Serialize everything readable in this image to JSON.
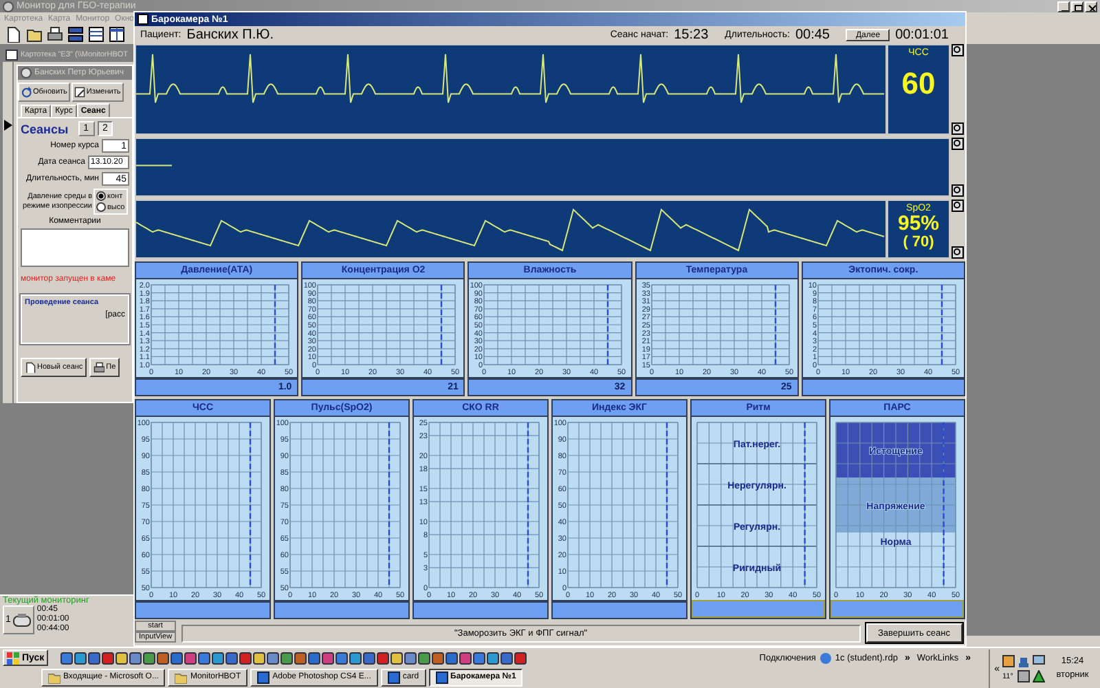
{
  "background_app": {
    "title": "Монитор для ГБО-терапии",
    "menu": [
      "Картотека",
      "Карта",
      "Монитор",
      "Окно"
    ],
    "card_window": {
      "title": "Картотека \"ЕЗ\" (\\\\MonitorHBOT",
      "patient_window": {
        "title": "Банских Петр Юрьевич",
        "buttons": [
          "Обновить",
          "Изменить"
        ],
        "tabs": [
          {
            "label": "Карта",
            "selected": false
          },
          {
            "label": "Курс",
            "selected": false
          },
          {
            "label": "Сеанс",
            "selected": true
          }
        ],
        "sessions_label": "Сеансы",
        "session_tabs": [
          {
            "label": "1",
            "selected": false
          },
          {
            "label": "2",
            "selected": true
          }
        ],
        "fields": [
          {
            "label": "Номер курса",
            "value": "1"
          },
          {
            "label": "Дата сеанса",
            "value": "13.10.20"
          },
          {
            "label": "Длительность, мин",
            "value": "45"
          }
        ],
        "pressure_label": "Давление среды в режиме изопрессии",
        "pressure_options": [
          {
            "label": "конт",
            "selected": true
          },
          {
            "label": "высо",
            "selected": false
          }
        ],
        "comments_label": "Комментарии",
        "status_message": "монитор запущен в каме",
        "session_group": {
          "title": "Проведение сеанса",
          "text": "[расс"
        },
        "bottom_buttons": [
          "Новый сеанс",
          "Пе"
        ]
      }
    },
    "monitoring_panel": {
      "title": "Текущий мониторинг",
      "items": [
        {
          "number": "1",
          "times": [
            "00:45",
            "00:01:00",
            "00:44:00"
          ]
        }
      ]
    }
  },
  "chamber_window": {
    "title": "Барокамера №1",
    "patient_label": "Пациент:",
    "patient": "Банских П.Ю.",
    "start_label": "Сеанс начат:",
    "start_time": "15:23",
    "duration_label": "Длительность:",
    "duration": "00:45",
    "next_button": "Далее",
    "elapsed": "00:01:01",
    "monitors": [
      {
        "kind": "ecg",
        "label": "ЧСС",
        "value": "60"
      },
      {
        "kind": "empty"
      },
      {
        "kind": "pulse",
        "label": "SpO2",
        "value": "95%",
        "sub_value": "( 70)"
      }
    ],
    "trend_rows": [
      [
        {
          "title": "Давление(АТА)",
          "reading": "1.0",
          "chart_data": {
            "type": "line",
            "grid": true,
            "xlim": [
              0,
              50
            ],
            "ylim": [
              1,
              2
            ],
            "xticks": [
              0,
              10,
              20,
              30,
              40,
              50
            ],
            "yticks": [
              {
                "value": 1,
                "label": "1.0"
              },
              1.1,
              1.2,
              1.3,
              1.4,
              1.5,
              1.6,
              1.7,
              1.8,
              1.9,
              {
                "value": 2,
                "label": "2.0"
              }
            ],
            "ref_lines": [
              {
                "axis": "x",
                "value": 45,
                "color": "#2a4ae0"
              }
            ]
          }
        },
        {
          "title": "Концентрация O2",
          "reading": "21",
          "chart_data": {
            "type": "line",
            "grid": true,
            "xlim": [
              0,
              50
            ],
            "ylim": [
              0,
              100
            ],
            "xticks": [
              0,
              10,
              20,
              30,
              40,
              50
            ],
            "yticks": [
              0,
              10,
              20,
              30,
              40,
              50,
              60,
              70,
              80,
              90,
              100
            ],
            "ref_lines": [
              {
                "axis": "x",
                "value": 45,
                "color": "#2a4ae0"
              }
            ]
          }
        },
        {
          "title": "Влажность",
          "reading": "32",
          "chart_data": {
            "type": "line",
            "grid": true,
            "xlim": [
              0,
              50
            ],
            "ylim": [
              0,
              100
            ],
            "xticks": [
              0,
              10,
              20,
              30,
              40,
              50
            ],
            "yticks": [
              0,
              10,
              20,
              30,
              40,
              50,
              60,
              70,
              80,
              90,
              100
            ],
            "ref_lines": [
              {
                "axis": "x",
                "value": 45,
                "color": "#2a4ae0"
              }
            ]
          }
        },
        {
          "title": "Температура",
          "reading": "25",
          "chart_data": {
            "type": "line",
            "grid": true,
            "xlim": [
              0,
              50
            ],
            "ylim": [
              15,
              35
            ],
            "xticks": [
              0,
              10,
              20,
              30,
              40,
              50
            ],
            "yticks": [
              15,
              17,
              19,
              21,
              23,
              25,
              27,
              29,
              31,
              33,
              35
            ],
            "ref_lines": [
              {
                "axis": "x",
                "value": 45,
                "color": "#2a4ae0"
              }
            ]
          }
        },
        {
          "title": "Эктопич. сокр.",
          "chart_data": {
            "type": "line",
            "grid": true,
            "xlim": [
              0,
              50
            ],
            "ylim": [
              0,
              10
            ],
            "xticks": [
              0,
              10,
              20,
              30,
              40,
              50
            ],
            "yticks": [
              0,
              1,
              2,
              3,
              4,
              5,
              6,
              7,
              8,
              9,
              10
            ],
            "ref_lines": [
              {
                "axis": "x",
                "value": 45,
                "color": "#2a4ae0"
              }
            ]
          }
        }
      ],
      [
        {
          "title": "ЧСС",
          "chart_data": {
            "type": "line",
            "grid": true,
            "xlim": [
              0,
              50
            ],
            "ylim": [
              50,
              100
            ],
            "xticks": [
              0,
              10,
              20,
              30,
              40,
              50
            ],
            "yticks": [
              50,
              55,
              60,
              65,
              70,
              75,
              80,
              85,
              90,
              95,
              100
            ],
            "ref_lines": [
              {
                "axis": "x",
                "value": 45,
                "color": "#2a4ae0"
              }
            ]
          }
        },
        {
          "title": "Пульс(SpO2)",
          "chart_data": {
            "type": "line",
            "grid": true,
            "xlim": [
              0,
              50
            ],
            "ylim": [
              50,
              100
            ],
            "xticks": [
              0,
              10,
              20,
              30,
              40,
              50
            ],
            "yticks": [
              50,
              55,
              60,
              65,
              70,
              75,
              80,
              85,
              90,
              95,
              100
            ],
            "ref_lines": [
              {
                "axis": "x",
                "value": 45,
                "color": "#2a4ae0"
              }
            ]
          }
        },
        {
          "title": "СКО RR",
          "chart_data": {
            "type": "line",
            "grid": true,
            "xlim": [
              0,
              50
            ],
            "ylim": [
              0,
              25
            ],
            "xticks": [
              0,
              10,
              20,
              30,
              40,
              50
            ],
            "yticks": [
              0,
              3,
              5,
              8,
              10,
              13,
              15,
              18,
              20,
              23,
              25
            ],
            "ref_lines": [
              {
                "axis": "x",
                "value": 45,
                "color": "#2a4ae0"
              }
            ]
          }
        },
        {
          "title": "Индекс ЭКГ",
          "chart_data": {
            "type": "line",
            "grid": true,
            "xlim": [
              0,
              50
            ],
            "ylim": [
              0,
              100
            ],
            "xticks": [
              0,
              10,
              20,
              30,
              40,
              50
            ],
            "yticks": [
              0,
              10,
              20,
              30,
              40,
              50,
              60,
              70,
              80,
              90,
              100
            ],
            "ref_lines": [
              {
                "axis": "x",
                "value": 45,
                "color": "#2a4ae0"
              }
            ]
          }
        },
        {
          "title": "Ритм",
          "bands": [
            {
              "label": "Пат.нерег."
            },
            {
              "label": "Нерегулярн."
            },
            {
              "label": "Регулярн."
            },
            {
              "label": "Ригидный"
            }
          ],
          "axis_labels": [
            "0",
            "10",
            "20",
            "30",
            "40",
            "50"
          ]
        },
        {
          "title": "ПАРС",
          "bands": [
            {
              "label": "Истощение",
              "color": "#3b4fb5"
            },
            {
              "label": "Напряжение",
              "color": "#7fa9d6"
            },
            {
              "label": "Норма",
              "color": "#bcdcf4"
            }
          ],
          "axis_labels": [
            "0",
            "10",
            "20",
            "30",
            "40",
            "50"
          ]
        }
      ]
    ],
    "small_buttons": [
      "start",
      "InputView"
    ],
    "freeze_button": "\"Заморозить ЭКГ и ФПГ сигнал\"",
    "finish_button": "Завершить сеанс"
  },
  "taskbar": {
    "start_button": "Пуск",
    "connections_label": "Подключения",
    "connection": "1c (student).rdp",
    "more_left": "»",
    "links": "WorkLinks",
    "more_right": "»",
    "tray_expand": "«",
    "temperature": "11°",
    "time": "15:24",
    "day": "вторник",
    "tasks": [
      {
        "label": "Входящие - Microsoft O...",
        "selected": false
      },
      {
        "label": "MonitorHBOT",
        "selected": false
      },
      {
        "label": "Adobe Photoshop CS4 E...",
        "selected": false
      },
      {
        "label": "card",
        "selected": false
      },
      {
        "label": "Барокамера №1",
        "selected": true
      }
    ]
  }
}
